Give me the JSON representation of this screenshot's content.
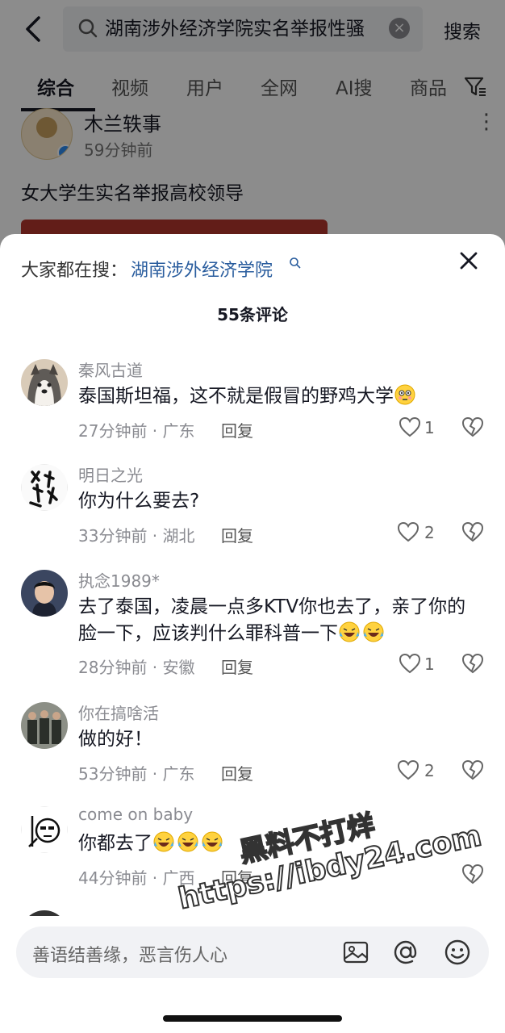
{
  "search": {
    "query": "湖南涉外经济学院实名举报性骚",
    "button": "搜索"
  },
  "tabs": [
    "综合",
    "视频",
    "用户",
    "全网",
    "AI搜",
    "商品"
  ],
  "post": {
    "author": "木兰轶事",
    "time": "59分钟前",
    "title": "女大学生实名举报高校领导"
  },
  "sheet": {
    "suggest_label": "大家都在搜：",
    "suggest_link": "湖南涉外经济学院",
    "comment_count": "55条评论"
  },
  "comments": [
    {
      "name": "秦风古道",
      "text": "泰国斯坦福，这不就是假冒的野鸡大学",
      "emojis": [
        "flushed"
      ],
      "meta": "27分钟前 · 广东",
      "reply": "回复",
      "likes": "1"
    },
    {
      "name": "明日之光",
      "text": "你为什么要去?",
      "emojis": [],
      "meta": "33分钟前 · 湖北",
      "reply": "回复",
      "likes": "2"
    },
    {
      "name": "执念1989*",
      "text": "去了泰国，凌晨一点多KTV你也去了，亲了你的脸一下，应该判什么罪科普一下",
      "emojis": [
        "laugh-cry",
        "laugh-cry"
      ],
      "meta": "28分钟前 · 安徽",
      "reply": "回复",
      "likes": "1"
    },
    {
      "name": "你在搞啥活",
      "text": "做的好！",
      "emojis": [],
      "meta": "53分钟前 · 广东",
      "reply": "回复",
      "likes": "2"
    },
    {
      "name": "come on baby",
      "text": "你都去了",
      "emojis": [
        "laugh-cry",
        "laugh-cry",
        "laugh-cry"
      ],
      "meta": "44分钟前 · 广西",
      "reply": "回复",
      "likes": ""
    }
  ],
  "input": {
    "placeholder": "善语结善缘，恶言伤人心"
  },
  "watermark": {
    "line1": "黑料不打烊",
    "line2": "https://ibdy24.com"
  },
  "icons": {
    "back": "chevron-left-icon",
    "search": "search-icon",
    "clear": "clear-icon",
    "filter": "filter-icon",
    "close": "close-icon",
    "like": "heart-icon",
    "dislike": "broken-heart-icon",
    "image": "image-icon",
    "mention": "at-icon",
    "emoji": "emoji-icon"
  }
}
